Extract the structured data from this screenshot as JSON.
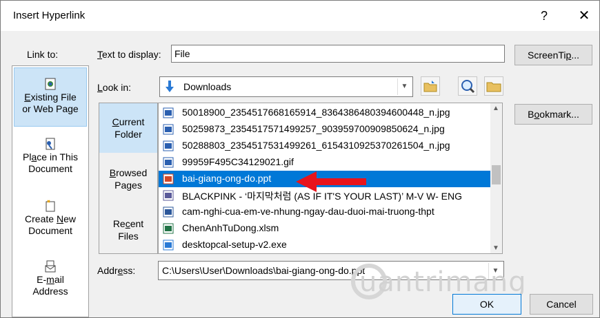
{
  "dialog": {
    "title": "Insert Hyperlink",
    "help": "?",
    "close": "✕"
  },
  "link_to": {
    "label": "Link to:",
    "items": [
      {
        "label_line1_pre": "",
        "label_line1_ul": "E",
        "label_line1_post": "xisting File",
        "label_line2": "or Web Page",
        "icon": "existing-file-icon"
      },
      {
        "label_line1_pre": "Pl",
        "label_line1_ul": "a",
        "label_line1_post": "ce in This",
        "label_line2": "Document",
        "icon": "place-in-document-icon"
      },
      {
        "label_line1_pre": "Create ",
        "label_line1_ul": "N",
        "label_line1_post": "ew",
        "label_line2": "Document",
        "icon": "new-document-icon"
      },
      {
        "label_line1_pre": "E-",
        "label_line1_ul": "m",
        "label_line1_post": "ail",
        "label_line2": "Address",
        "icon": "email-icon"
      }
    ]
  },
  "text_to_display": {
    "label_ul": "T",
    "label_rest": "ext to display:",
    "value": "File"
  },
  "screentip": {
    "pre": "ScreenTi",
    "ul": "p",
    "post": "..."
  },
  "look_in": {
    "label_ul": "L",
    "label_rest": "ook in:",
    "value": "Downloads"
  },
  "bookmark": {
    "pre": "B",
    "ul": "o",
    "post": "okmark..."
  },
  "side_tabs": [
    {
      "pre": "",
      "ul": "C",
      "post": "urrent",
      "line2": "Folder"
    },
    {
      "pre": "",
      "ul": "B",
      "post": "rowsed",
      "line2": "Pages"
    },
    {
      "pre": "Re",
      "ul": "c",
      "post": "ent",
      "line2": "Files"
    }
  ],
  "files": [
    {
      "name": "50018900_2354517668165914_8364386480394600448_n.jpg",
      "type": "image"
    },
    {
      "name": "50259873_2354517571499257_903959700909850624_n.jpg",
      "type": "image"
    },
    {
      "name": "50288803_2354517531499261_6154310925370261504_n.jpg",
      "type": "image"
    },
    {
      "name": "99959F495C34129021.gif",
      "type": "image"
    },
    {
      "name": "bai-giang-ong-do.ppt",
      "type": "ppt",
      "selected": true
    },
    {
      "name": "BLACKPINK - ‘마지막처럼 (AS IF IT'S YOUR LAST)’ M-V W- ENG",
      "type": "video"
    },
    {
      "name": "cam-nghi-cua-em-ve-nhung-ngay-dau-duoi-mai-truong-thpt",
      "type": "doc"
    },
    {
      "name": "ChenAnhTuDong.xlsm",
      "type": "xls"
    },
    {
      "name": "desktopcal-setup-v2.exe",
      "type": "exe"
    }
  ],
  "address": {
    "label_pre": "Addr",
    "label_ul": "e",
    "label_post": "ss:",
    "value": "C:\\Users\\User\\Downloads\\bai-giang-ong-do.ppt"
  },
  "ok_label": "OK",
  "cancel_label": "Cancel",
  "watermark": "uantrimang",
  "colors": {
    "selection": "#0078d7",
    "link_selected": "#cce4f7",
    "arrow": "#e8141c"
  }
}
